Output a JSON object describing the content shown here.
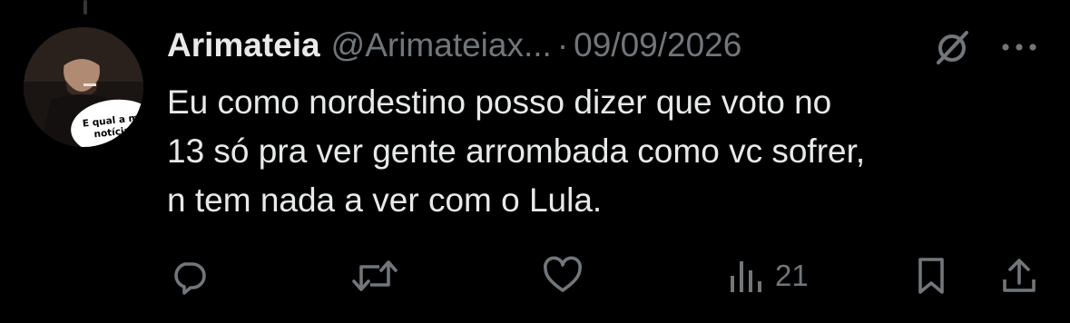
{
  "tweet": {
    "display_name": "Arimateia",
    "handle": "@Arimateiax...",
    "separator": "·",
    "date": "09/09/2026",
    "text": "Eu como nordestino posso dizer que voto no\n13 só pra ver gente arrombada como vc sofrer,\nn tem nada a ver com o Lula."
  },
  "avatar": {
    "caption_line1": "E qual a má",
    "caption_line2": "notícia?"
  },
  "actions": {
    "reply_icon": "reply-icon",
    "retweet_icon": "retweet-icon",
    "like_icon": "like-icon",
    "views_icon": "views-icon",
    "views_count": "21",
    "bookmark_icon": "bookmark-icon",
    "share_icon": "share-icon"
  },
  "colors": {
    "background": "#000000",
    "primary_text": "#e7e9ea",
    "secondary_text": "#71767b"
  }
}
